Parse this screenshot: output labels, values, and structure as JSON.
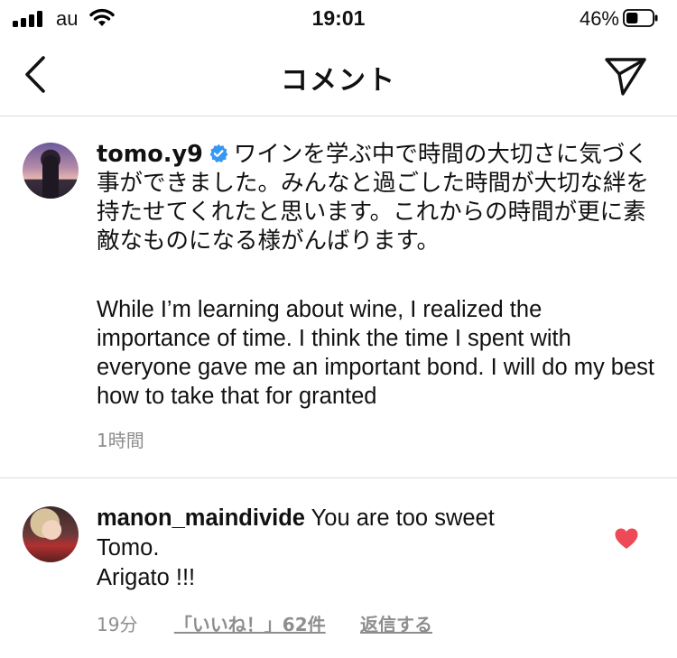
{
  "status_bar": {
    "carrier": "au",
    "time": "19:01",
    "battery_percent": "46%",
    "battery_level": 0.46,
    "icons": [
      "signal-icon",
      "wifi-icon",
      "battery-icon"
    ]
  },
  "header": {
    "title": "コメント",
    "back_icon": "chevron-left-icon",
    "send_icon": "paper-plane-icon"
  },
  "caption": {
    "username": "tomo.y9",
    "verified": true,
    "text_ja": "ワインを学ぶ中で時間の大切さに気づく事ができました。みんなと過ごした時間が大切な絆を持たせてくれたと思います。これからの時間が更に素敵なものになる様がんばります。",
    "text_en": "While I’m learning about wine, I realized the importance of time.  I think the time I spent with everyone gave me an important bond.  I will do my best how to take that for granted",
    "time": "1時間"
  },
  "comment": {
    "username": "manon_maindivide",
    "text_line1": "You are too sweet",
    "text_line2": "Tomo.",
    "text_line3": "Arigato !!!",
    "time": "19分",
    "likes": "「いいね！」62件",
    "reply": "返信する",
    "liked": true,
    "heart_color": "#ed4956"
  },
  "colors": {
    "verified_blue": "#3897f0",
    "secondary_text": "#8e8e8e",
    "divider": "#dbdbdb"
  }
}
